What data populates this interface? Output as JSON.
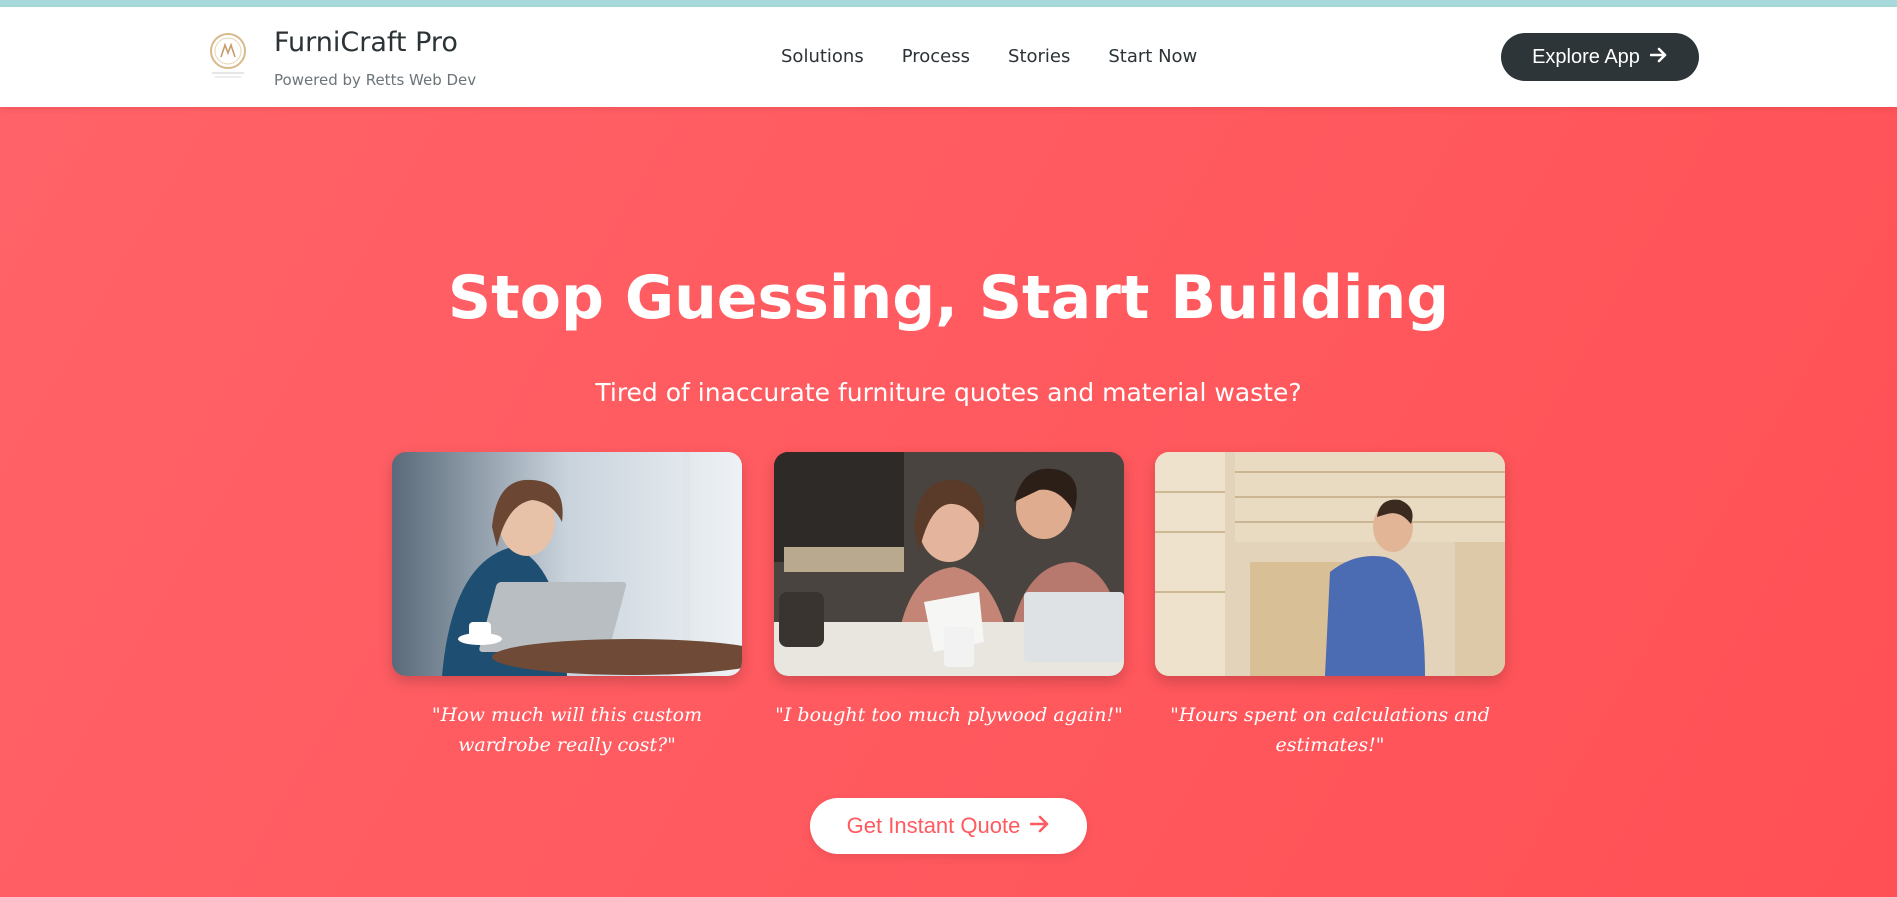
{
  "brand": {
    "title": "FurniCraft Pro",
    "subtitle": "Powered by Retts Web Dev",
    "logo_icon": "gold-circle-monogram-logo"
  },
  "nav": {
    "links": [
      "Solutions",
      "Process",
      "Stories",
      "Start Now"
    ],
    "explore_label": "Explore App",
    "explore_icon": "arrow-right-icon"
  },
  "hero": {
    "title": "Stop Guessing, Start Building",
    "subtitle": "Tired of inaccurate furniture quotes and material waste?",
    "cards": [
      {
        "image": "woman-worried-at-laptop-photo",
        "caption": "\"How much will this custom wardrobe really cost?\""
      },
      {
        "image": "couple-reviewing-bills-photo",
        "caption": "\"I bought too much plywood again!\""
      },
      {
        "image": "man-holding-plywood-sheet-photo",
        "caption": "\"Hours spent on calculations and estimates!\""
      }
    ],
    "cta_label": "Get Instant Quote",
    "cta_icon": "arrow-right-icon"
  },
  "colors": {
    "accent": "#ff5a5f",
    "nav_button": "#2d3538",
    "top_strip": "#a8dadc"
  }
}
